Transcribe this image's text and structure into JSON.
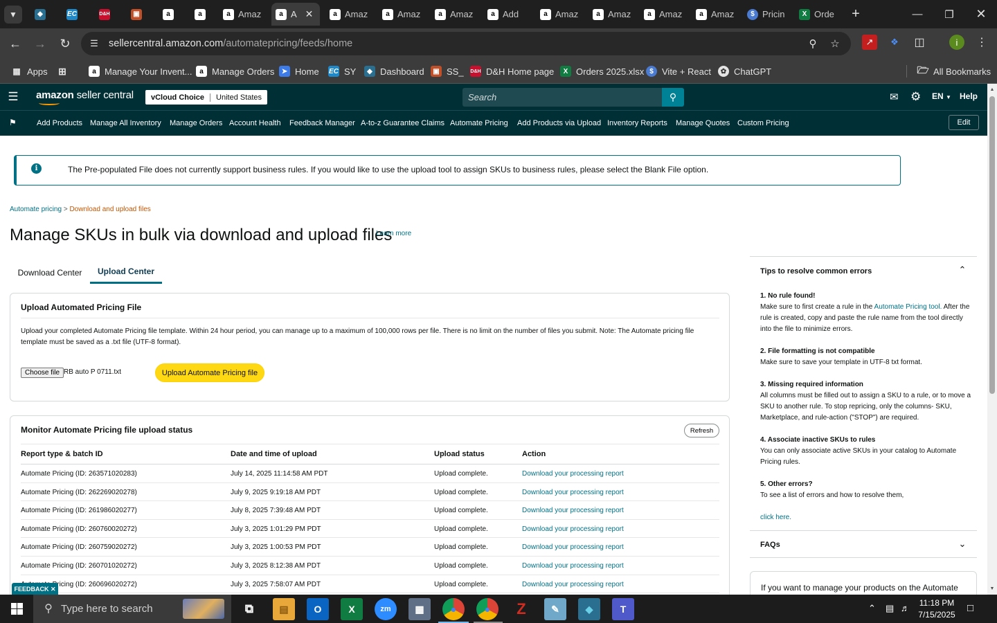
{
  "browser": {
    "tabs": [
      {
        "icon": "chevron-down"
      },
      {
        "icon": "diamond",
        "label": ""
      },
      {
        "icon": "ec",
        "label": ""
      },
      {
        "icon": "dh",
        "label": ""
      },
      {
        "icon": "cube",
        "label": ""
      },
      {
        "icon": "amazon",
        "label": ""
      },
      {
        "icon": "amazon",
        "label": ""
      },
      {
        "icon": "amazon",
        "label": "Amaz"
      },
      {
        "icon": "amazon",
        "label": "A",
        "active": true
      },
      {
        "icon": "amazon",
        "label": "Amaz"
      },
      {
        "icon": "amazon",
        "label": "Amaz"
      },
      {
        "icon": "amazon",
        "label": "Amaz"
      },
      {
        "icon": "amazon",
        "label": "Add"
      },
      {
        "icon": "amazon",
        "label": "Amaz"
      },
      {
        "icon": "amazon",
        "label": "Amaz"
      },
      {
        "icon": "amazon",
        "label": "Amaz"
      },
      {
        "icon": "amazon",
        "label": "Amaz"
      },
      {
        "icon": "dollar",
        "label": "Pricin"
      },
      {
        "icon": "excel",
        "label": "Orde"
      }
    ],
    "url_host": "sellercentral.amazon.com",
    "url_path": "/automatepricing/feeds/home",
    "bookmarks": {
      "apps": "Apps",
      "manage_inventory": "Manage Your Invent...",
      "manage_orders": "Manage Orders",
      "home": "Home",
      "sy": "SY",
      "dashboard": "Dashboard",
      "ss": "SS_",
      "dh_home": "D&H Home page",
      "orders_xlsx": "Orders 2025.xlsx",
      "vite_react": "Vite + React",
      "chatgpt": "ChatGPT",
      "all_bookmarks": "All Bookmarks"
    },
    "profile_initial": "i"
  },
  "seller_central": {
    "logo_main": "amazon",
    "logo_sub": "seller central",
    "store_account": "vCloud Choice",
    "store_marketplace": "United States",
    "search_placeholder": "Search",
    "language": "EN",
    "help": "Help",
    "nav": {
      "add_products": "Add Products",
      "manage_all_inventory": "Manage All Inventory",
      "manage_orders": "Manage Orders",
      "account_health": "Account Health",
      "feedback_manager": "Feedback Manager",
      "atoz_claims": "A-to-z Guarantee Claims",
      "automate_pricing": "Automate Pricing",
      "add_products_upload": "Add Products via Upload",
      "inventory_reports": "Inventory Reports",
      "manage_quotes": "Manage Quotes",
      "custom_pricing": "Custom Pricing",
      "edit": "Edit"
    }
  },
  "alert": {
    "text": "The Pre-populated File does not currently support business rules. If you would like to use the upload tool to assign SKUs to business rules, please select the Blank File option."
  },
  "breadcrumb": {
    "root": "Automate pricing",
    "separator": " > ",
    "current": "Download and upload files"
  },
  "page_title": "Manage SKUs in bulk via download and upload files",
  "learn_more": "Learn more",
  "tabs": {
    "download_center": "Download Center",
    "upload_center": "Upload Center"
  },
  "upload_card": {
    "title": "Upload Automated Pricing File",
    "description": "Upload your completed Automate Pricing file template. Within 24 hour period, you can manage up to a maximum of 100,000 rows per file. There is no limit on the number of files you submit. Note: The Automate pricing file template must be saved as a .txt file (UTF-8 format).",
    "choose_file": "Choose file",
    "file_name": "RB auto P 0711.txt",
    "upload_button": "Upload Automate Pricing file"
  },
  "monitor_card": {
    "title": "Monitor Automate Pricing file upload status",
    "refresh": "Refresh",
    "headers": [
      "Report type & batch ID",
      "Date and time of upload",
      "Upload status",
      "Action"
    ],
    "rows": [
      [
        "Automate Pricing (ID: 263571020283)",
        "July 14, 2025 11:14:58 AM PDT",
        "Upload complete.",
        "Download your processing report"
      ],
      [
        "Automate Pricing (ID: 262269020278)",
        "July 9, 2025 9:19:18 AM PDT",
        "Upload complete.",
        "Download your processing report"
      ],
      [
        "Automate Pricing (ID: 261986020277)",
        "July 8, 2025 7:39:48 AM PDT",
        "Upload complete.",
        "Download your processing report"
      ],
      [
        "Automate Pricing (ID: 260760020272)",
        "July 3, 2025 1:01:29 PM PDT",
        "Upload complete.",
        "Download your processing report"
      ],
      [
        "Automate Pricing (ID: 260759020272)",
        "July 3, 2025 1:00:53 PM PDT",
        "Upload complete.",
        "Download your processing report"
      ],
      [
        "Automate Pricing (ID: 260701020272)",
        "July 3, 2025 8:12:38 AM PDT",
        "Upload complete.",
        "Download your processing report"
      ],
      [
        "Automate Pricing (ID: 260696020272)",
        "July 3, 2025 7:58:07 AM PDT",
        "Upload complete.",
        "Download your processing report"
      ]
    ]
  },
  "tips": {
    "title": "Tips to resolve common errors",
    "t1_head": "1. No rule found!",
    "t1_a": "Make sure to first create a rule in the ",
    "t1_link": "Automate Pricing tool.",
    "t1_b": "  After the rule is created, copy and paste the rule name from the tool directly into the file to minimize errors.",
    "t2_head": "2. File formatting is not compatible",
    "t2_body": "Make sure to save your template in UTF-8 txt format.",
    "t3_head": "3. Missing required information",
    "t3_body": "All columns must be filled out to assign a SKU to a rule, or to move a SKU to another rule. To stop repricing, only the columns- SKU, Marketplace, and rule-action (\"STOP\") are required.",
    "t4_head": "4. Associate inactive SKUs to rules",
    "t4_body": "You can only associate active SKUs in your catalog to Automate Pricing rules.",
    "t5_head": "5. Other errors?",
    "t5_body": "To see a list of errors and how to resolve them,",
    "t5_link": "click here."
  },
  "faqs": "FAQs",
  "promo": "If you want to manage your products on the Automate Pricing tool with larger volumes...",
  "feedback": "FEEDBACK",
  "taskbar": {
    "search_placeholder": "Type here to search",
    "time": "11:18 PM",
    "date": "7/15/2025"
  },
  "colors": {
    "accent": "#007185",
    "header": "#002f36",
    "upload_button": "#ffd814",
    "breadcrumb_current": "#c45500"
  }
}
